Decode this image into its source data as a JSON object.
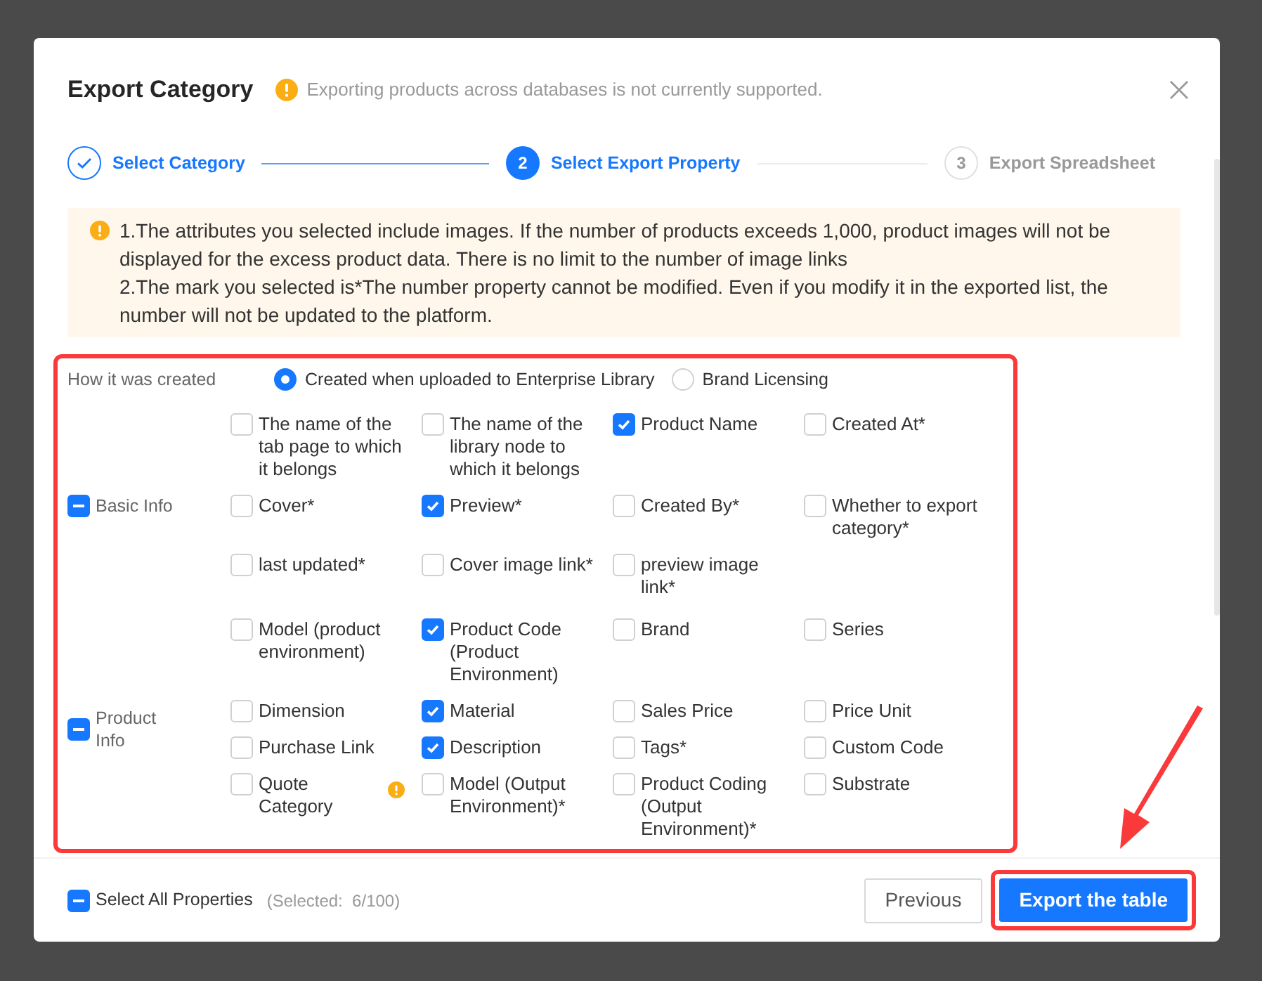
{
  "dialog": {
    "title": "Export Category",
    "notice": "Exporting products across databases is not currently supported."
  },
  "steps": [
    {
      "label": "Select Category",
      "completed": true,
      "current": false
    },
    {
      "number": "2",
      "label": "Select Export Property",
      "completed": false,
      "current": true
    },
    {
      "number": "3",
      "label": "Export Spreadsheet",
      "completed": false,
      "current": false
    }
  ],
  "alert": [
    "1.The attributes you selected include images. If the number of products exceeds 1,000, product images will not be displayed for the excess product data. There is no limit to the number of image links",
    "2.The mark you selected is*The number property cannot be modified. Even if you modify it in the exported list, the number will not be updated to the platform."
  ],
  "creation": {
    "label": "How it was created",
    "options": [
      {
        "label": "Created when uploaded to Enterprise Library",
        "selected": true
      },
      {
        "label": "Brand Licensing",
        "selected": false
      }
    ]
  },
  "groups": [
    {
      "label": "Basic Info",
      "indeterminate": true,
      "items": [
        {
          "label": "The name of the tab page to which it belongs",
          "checked": false
        },
        {
          "label": "The name of the library node to which it belongs",
          "checked": false
        },
        {
          "label": "Product Name",
          "checked": true
        },
        {
          "label": "Created At*",
          "checked": false
        },
        {
          "label": "Cover*",
          "checked": false
        },
        {
          "label": "Preview*",
          "checked": true
        },
        {
          "label": "Created By*",
          "checked": false
        },
        {
          "label": "Whether to export category*",
          "checked": false
        },
        {
          "label": "last updated*",
          "checked": false
        },
        {
          "label": "Cover image link*",
          "checked": false
        },
        {
          "label": "preview image link*",
          "checked": false
        }
      ]
    },
    {
      "label": "Product Info",
      "indeterminate": true,
      "items": [
        {
          "label": "Model (product environment)",
          "checked": false
        },
        {
          "label": "Product Code (Product Environment)",
          "checked": true
        },
        {
          "label": "Brand",
          "checked": false
        },
        {
          "label": "Series",
          "checked": false
        },
        {
          "label": "Dimension",
          "checked": false
        },
        {
          "label": "Material",
          "checked": true
        },
        {
          "label": "Sales Price",
          "checked": false
        },
        {
          "label": "Price Unit",
          "checked": false
        },
        {
          "label": "Purchase Link",
          "checked": false
        },
        {
          "label": "Description",
          "checked": true
        },
        {
          "label": "Tags*",
          "checked": false
        },
        {
          "label": "Custom Code",
          "checked": false
        },
        {
          "label": "Quote Category",
          "checked": false,
          "warning": true
        },
        {
          "label": "Model (Output Environment)*",
          "checked": false
        },
        {
          "label": "Product Coding (Output Environment)*",
          "checked": false
        },
        {
          "label": "Substrate",
          "checked": false
        }
      ]
    }
  ],
  "footer": {
    "select_all": {
      "label": "Select All Properties",
      "indeterminate": true
    },
    "count": "(Selected:  6/100)",
    "buttons": [
      {
        "label": "Previous",
        "kind": "secondary"
      },
      {
        "label": "Export the table",
        "kind": "primary"
      }
    ]
  }
}
